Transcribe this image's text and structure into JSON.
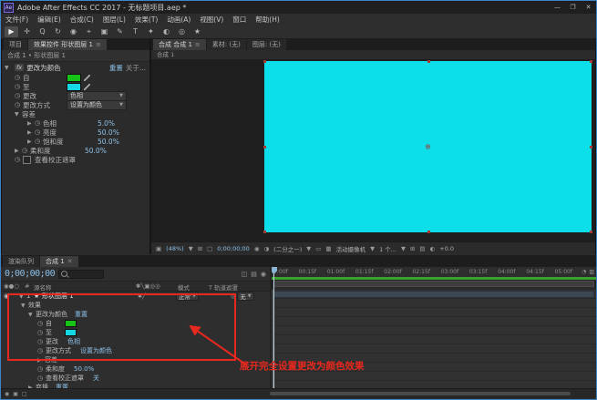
{
  "window": {
    "title": "Adobe After Effects CC 2017 - 无标题项目.aep *",
    "app_badge": "Ae",
    "minimize": "—",
    "maximize": "❐",
    "close": "✕"
  },
  "menu": {
    "items": [
      "文件(F)",
      "编辑(E)",
      "合成(C)",
      "图层(L)",
      "效果(T)",
      "动画(A)",
      "视图(V)",
      "窗口",
      "帮助(H)"
    ]
  },
  "toolbar": {
    "tools": [
      {
        "name": "selection-tool",
        "glyph": "▶"
      },
      {
        "name": "hand-tool",
        "glyph": "✛"
      },
      {
        "name": "zoom-tool",
        "glyph": "Q"
      },
      {
        "name": "rotation-tool",
        "glyph": "↻"
      },
      {
        "name": "camera-tool",
        "glyph": "◉"
      },
      {
        "name": "pan-behind-tool",
        "glyph": "⌖"
      },
      {
        "name": "shape-tool",
        "glyph": "▣"
      },
      {
        "name": "pen-tool",
        "glyph": "✎"
      },
      {
        "name": "type-tool",
        "glyph": "T"
      },
      {
        "name": "brush-tool",
        "glyph": "✦"
      },
      {
        "name": "clone-stamp-tool",
        "glyph": "◐"
      },
      {
        "name": "eraser-tool",
        "glyph": "◎"
      },
      {
        "name": "puppet-tool",
        "glyph": "★"
      }
    ]
  },
  "effect_controls": {
    "tab_project": "项目",
    "tab_active": "效果控件 形状图层 1",
    "breadcrumb": "合成 1 • 形状图层 1",
    "effect": {
      "fx_badge": "fx",
      "name": "更改为颜色",
      "reset_label": "重置",
      "about_label": "关于...",
      "params": {
        "from": {
          "label": "自",
          "color": "#17c317"
        },
        "to": {
          "label": "至",
          "color": "#15d8e4"
        },
        "change": {
          "label": "更改",
          "value": "色相"
        },
        "change_by": {
          "label": "更改方式",
          "value": "设置为颜色"
        },
        "tolerance": {
          "label": "容差",
          "hue": {
            "label": "色相",
            "value": "5.0%"
          },
          "lightness": {
            "label": "亮度",
            "value": "50.0%"
          },
          "saturation": {
            "label": "饱和度",
            "value": "50.0%"
          }
        },
        "softness": {
          "label": "柔和度",
          "value": "50.0%"
        },
        "view_matte": {
          "label": "查看校正遮罩"
        }
      }
    }
  },
  "viewer": {
    "tab_comp": "合成 合成 1",
    "tab_footage": "素材: (无)",
    "tab_layer": "图层: (无)",
    "comp_nav": "合成 1",
    "canvas_color": "#0cdfe9",
    "statusbar": {
      "zoom": "(48%)",
      "timecode": "0;00;00;00",
      "resolution": "(二分之一)",
      "camera": "活动摄像机",
      "views": "1 个...",
      "exposure": "+0.0"
    }
  },
  "timeline": {
    "tab_render_queue": "渲染队列",
    "tab_comp": "合成 1",
    "timecode": "0;00;00;00",
    "cache_bar_color": "#3aa32f",
    "columns": {
      "index": "#",
      "source": "源名称",
      "mode": "模式",
      "trkmat": "T 轨道遮罩"
    },
    "layer": {
      "index": "1",
      "name": "形状图层 1",
      "mode": "正常",
      "parent": "无"
    },
    "effects_group": "效果",
    "effect_name": "更改为颜色",
    "reset_label": "重置",
    "transform": {
      "label": "变换",
      "reset": "重置"
    },
    "params": {
      "from": {
        "label": "自"
      },
      "to": {
        "label": "至"
      },
      "change": {
        "label": "更改",
        "value": "色相"
      },
      "change_by": {
        "label": "更改方式",
        "value": "设置为颜色"
      },
      "tolerance": {
        "label": "容差"
      },
      "softness": {
        "label": "柔和度",
        "value": "50.0%"
      },
      "view_matte": {
        "label": "查看校正遮罩",
        "value": "关"
      }
    },
    "ruler_labels": [
      ":00f",
      "00:15f",
      "01:00f",
      "01:15f",
      "02:00f",
      "02:15f",
      "03:00f",
      "03:15f",
      "04:00f",
      "04:15f",
      "05:00f"
    ]
  },
  "annotation": {
    "text": "展开完全设置更改为颜色效果",
    "color": "#e8281e"
  }
}
